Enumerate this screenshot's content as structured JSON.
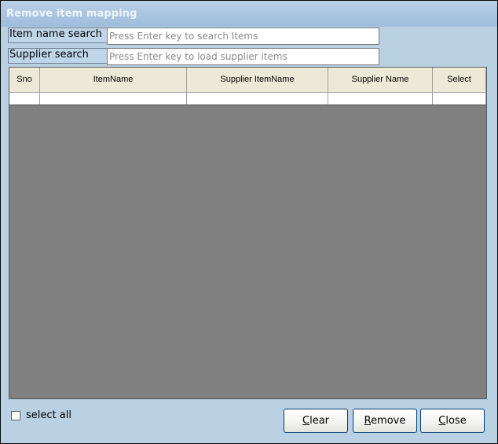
{
  "window": {
    "title": "Remove item mapping"
  },
  "search": {
    "item_label": "Item name search",
    "item_placeholder": "Press Enter key to search Items",
    "supplier_label": "Supplier search",
    "supplier_placeholder": "Press Enter key to load supplier items"
  },
  "grid": {
    "columns": [
      "Sno",
      "ItemName",
      "Supplier ItemName",
      "Supplier Name",
      "Select"
    ]
  },
  "footer": {
    "select_all_label": "select all",
    "buttons": {
      "clear": {
        "mnemonic": "C",
        "rest": "lear"
      },
      "remove": {
        "mnemonic": "R",
        "rest": "emove"
      },
      "close": {
        "mnemonic": "C",
        "rest": "lose"
      }
    }
  },
  "colors": {
    "titlebar": "#a9c4e0",
    "background": "#bad0e3",
    "grid_background": "#808080",
    "header": "#ece9d8"
  }
}
